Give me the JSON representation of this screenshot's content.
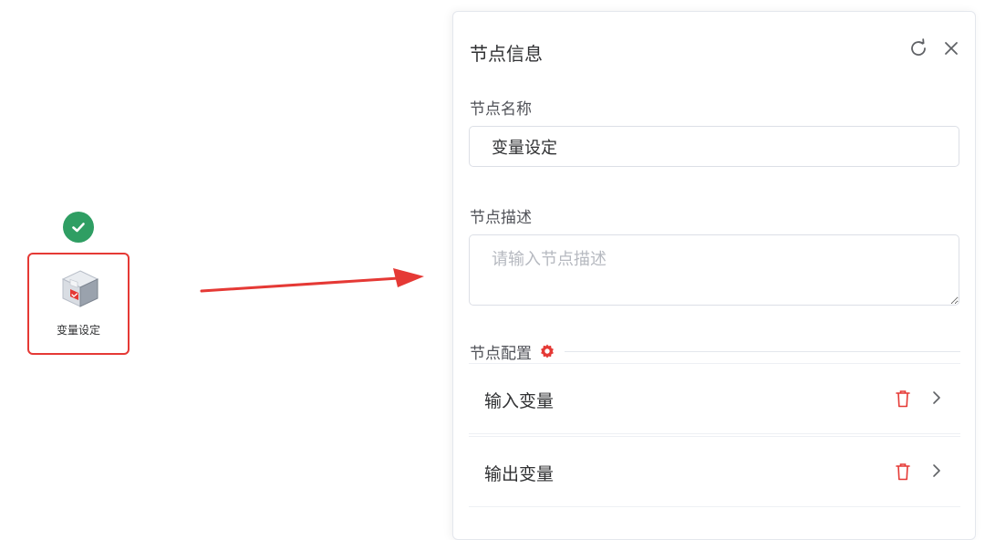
{
  "canvas": {
    "node": {
      "label": "变量设定",
      "status_icon": "check-circle-icon",
      "status_color": "#2f9e63",
      "highlight_color": "#e53935",
      "icon": "variable-box-icon"
    },
    "arrow_color": "#e53935"
  },
  "panel": {
    "title": "节点信息",
    "refresh_icon": "refresh-icon",
    "close_icon": "close-icon",
    "name_label": "节点名称",
    "name_value": "变量设定",
    "description_label": "节点描述",
    "description_placeholder": "请输入节点描述",
    "config_label": "节点配置",
    "config_icon": "gear-icon",
    "config_icon_color": "#e53935",
    "config_items": [
      {
        "label": "输入变量",
        "delete_icon": "trash-icon",
        "chevron_icon": "chevron-right-icon"
      },
      {
        "label": "输出变量",
        "delete_icon": "trash-icon",
        "chevron_icon": "chevron-right-icon"
      }
    ]
  }
}
